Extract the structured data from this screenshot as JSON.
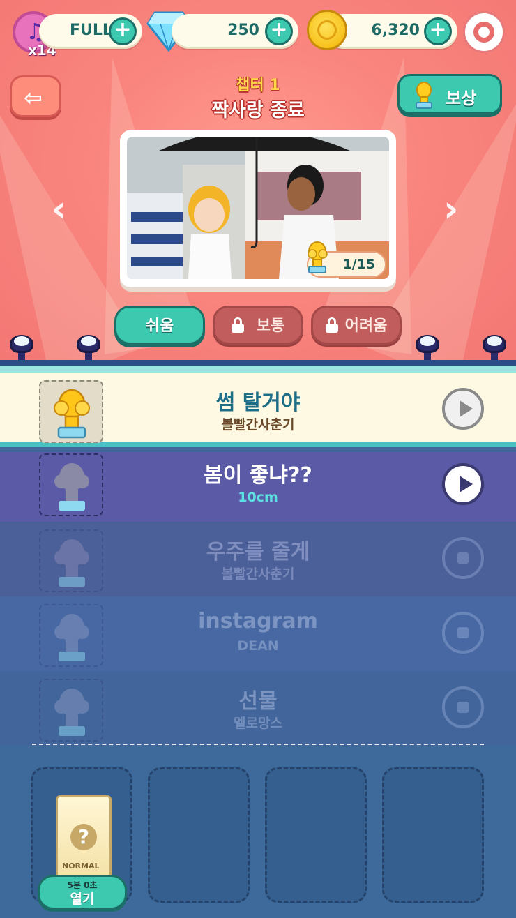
{
  "status_bar": {
    "music_count": "x14",
    "energy_label": "FULL",
    "gems": "250",
    "coins": "6,320"
  },
  "header": {
    "chapter": "챕터 1",
    "title": "짝사랑 종료",
    "reward_label": "보상"
  },
  "card": {
    "level_progress": "1/15"
  },
  "difficulty": {
    "easy": "쉬움",
    "normal": "보통",
    "hard": "어려움"
  },
  "songs": [
    {
      "title": "썸 탈거야",
      "artist": "볼빨간사춘기",
      "state": "cleared"
    },
    {
      "title": "봄이 좋냐??",
      "artist": "10cm",
      "state": "current"
    },
    {
      "title": "우주를 줄게",
      "artist": "볼빨간사춘기",
      "state": "locked"
    },
    {
      "title": "instagram",
      "artist": "DEAN",
      "state": "locked"
    },
    {
      "title": "선물",
      "artist": "멜로망스",
      "state": "locked"
    }
  ],
  "pack": {
    "label": "NORMAL",
    "timer": "5분 0초",
    "open_label": "열기"
  },
  "colors": {
    "accent_teal": "#3cc9b0",
    "stage_pink": "#f9857e",
    "list_blue": "#3d6a9a"
  }
}
